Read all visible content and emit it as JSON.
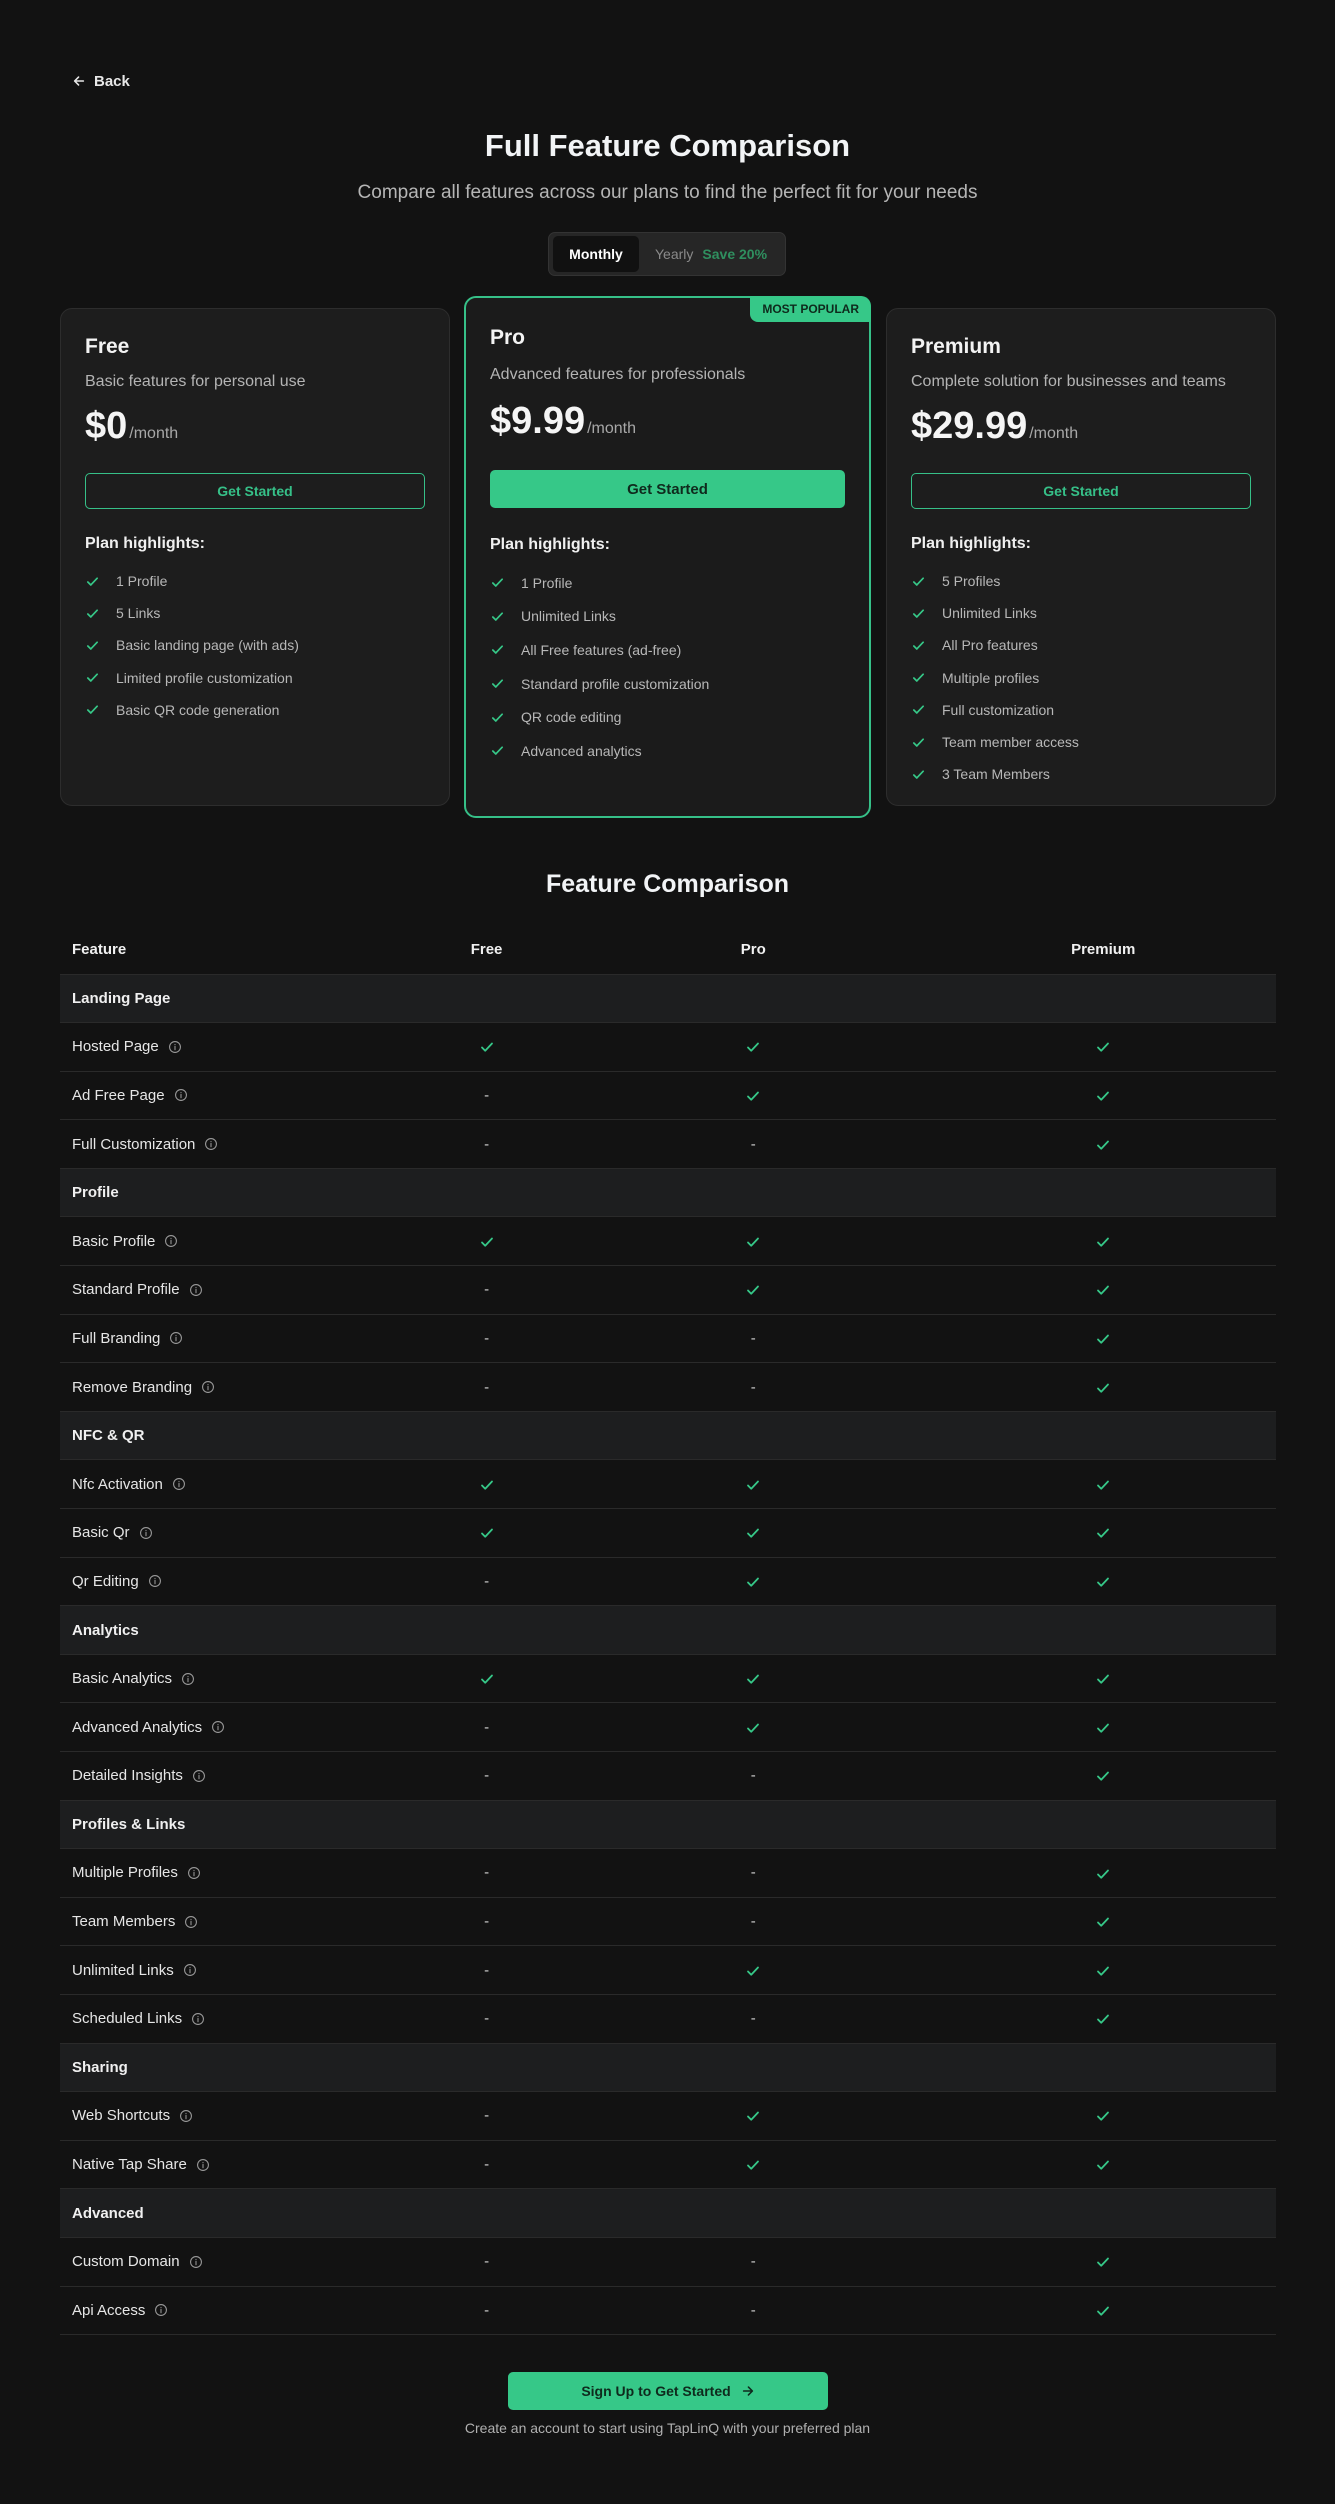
{
  "nav": {
    "back_label": "Back"
  },
  "header": {
    "title": "Full Feature Comparison",
    "subtitle": "Compare all features across our plans to find the perfect fit for your needs"
  },
  "billing_toggle": {
    "monthly": "Monthly",
    "yearly": "Yearly",
    "save": "Save 20%",
    "selected": "Monthly"
  },
  "plans": [
    {
      "name": "Free",
      "description": "Basic features for personal use",
      "price": "$0",
      "period": "/month",
      "button": "Get Started",
      "highlights_title": "Plan highlights:",
      "highlights": [
        "1 Profile",
        "5 Links",
        "Basic landing page (with ads)",
        "Limited profile customization",
        "Basic QR code generation"
      ]
    },
    {
      "name": "Pro",
      "badge": "MOST POPULAR",
      "description": "Advanced features for professionals",
      "price": "$9.99",
      "period": "/month",
      "button": "Get Started",
      "highlights_title": "Plan highlights:",
      "highlights": [
        "1 Profile",
        "Unlimited Links",
        "All Free features (ad-free)",
        "Standard profile customization",
        "QR code editing",
        "Advanced analytics"
      ]
    },
    {
      "name": "Premium",
      "description": "Complete solution for businesses and teams",
      "price": "$29.99",
      "period": "/month",
      "button": "Get Started",
      "highlights_title": "Plan highlights:",
      "highlights": [
        "5 Profiles",
        "Unlimited Links",
        "All Pro features",
        "Multiple profiles",
        "Full customization",
        "Team member access",
        "3 Team Members"
      ]
    }
  ],
  "comparison": {
    "title": "Feature Comparison",
    "columns": [
      "Feature",
      "Free",
      "Pro",
      "Premium"
    ],
    "dash": "-",
    "groups": [
      {
        "name": "Landing Page",
        "rows": [
          {
            "feature": "Hosted Page",
            "values": [
              true,
              true,
              true
            ]
          },
          {
            "feature": "Ad Free Page",
            "values": [
              false,
              true,
              true
            ]
          },
          {
            "feature": "Full Customization",
            "values": [
              false,
              false,
              true
            ]
          }
        ]
      },
      {
        "name": "Profile",
        "rows": [
          {
            "feature": "Basic Profile",
            "values": [
              true,
              true,
              true
            ]
          },
          {
            "feature": "Standard Profile",
            "values": [
              false,
              true,
              true
            ]
          },
          {
            "feature": "Full Branding",
            "values": [
              false,
              false,
              true
            ]
          },
          {
            "feature": "Remove Branding",
            "values": [
              false,
              false,
              true
            ]
          }
        ]
      },
      {
        "name": "NFC & QR",
        "rows": [
          {
            "feature": "Nfc Activation",
            "values": [
              true,
              true,
              true
            ]
          },
          {
            "feature": "Basic Qr",
            "values": [
              true,
              true,
              true
            ]
          },
          {
            "feature": "Qr Editing",
            "values": [
              false,
              true,
              true
            ]
          }
        ]
      },
      {
        "name": "Analytics",
        "rows": [
          {
            "feature": "Basic Analytics",
            "values": [
              true,
              true,
              true
            ]
          },
          {
            "feature": "Advanced Analytics",
            "values": [
              false,
              true,
              true
            ]
          },
          {
            "feature": "Detailed Insights",
            "values": [
              false,
              false,
              true
            ]
          }
        ]
      },
      {
        "name": "Profiles & Links",
        "rows": [
          {
            "feature": "Multiple Profiles",
            "values": [
              false,
              false,
              true
            ]
          },
          {
            "feature": "Team Members",
            "values": [
              false,
              false,
              true
            ]
          },
          {
            "feature": "Unlimited Links",
            "values": [
              false,
              true,
              true
            ]
          },
          {
            "feature": "Scheduled Links",
            "values": [
              false,
              false,
              true
            ]
          }
        ]
      },
      {
        "name": "Sharing",
        "rows": [
          {
            "feature": "Web Shortcuts",
            "values": [
              false,
              true,
              true
            ]
          },
          {
            "feature": "Native Tap Share",
            "values": [
              false,
              true,
              true
            ]
          }
        ]
      },
      {
        "name": "Advanced",
        "rows": [
          {
            "feature": "Custom Domain",
            "values": [
              false,
              false,
              true
            ]
          },
          {
            "feature": "Api Access",
            "values": [
              false,
              false,
              true
            ]
          }
        ]
      }
    ]
  },
  "cta": {
    "button": "Sign Up to Get Started",
    "note": "Create an account to start using TapLinQ with your preferred plan"
  },
  "colors": {
    "accent": "#36c888",
    "background": "#121212",
    "card": "#1d1d1d",
    "category_row": "#1d1e1f"
  }
}
